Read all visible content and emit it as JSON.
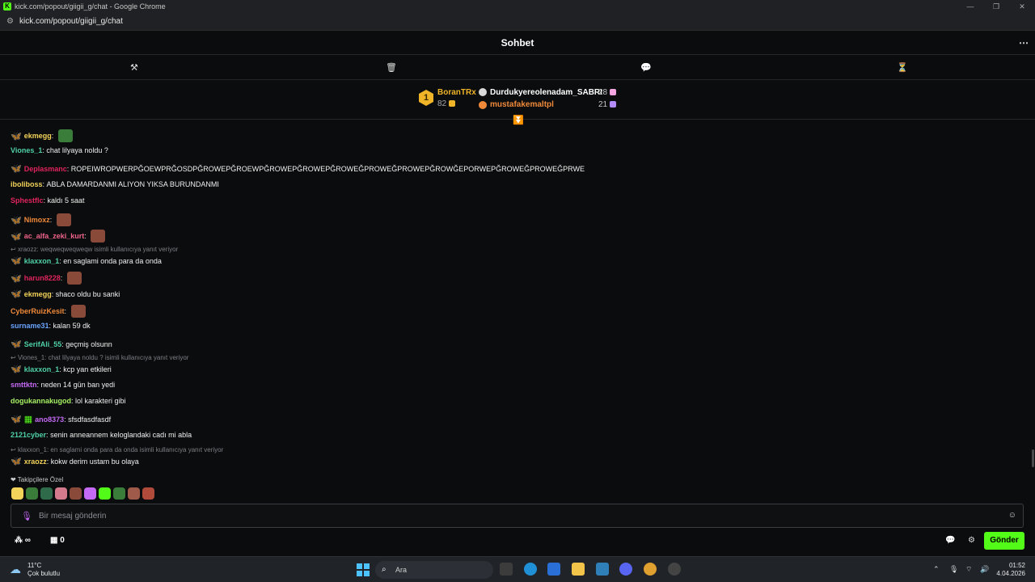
{
  "window": {
    "title": "kick.com/popout/giigii_g/chat - Google Chrome",
    "url": "kick.com/popout/giigii_g/chat"
  },
  "header": {
    "title": "Sohbet"
  },
  "leaderboard": {
    "rank1": {
      "rank": "1",
      "name": "BoranTRx",
      "count": "82"
    },
    "rank2": {
      "name": "Durdukyereolenadam_SABRI",
      "count": "28"
    },
    "rank3": {
      "name": "mustafakemaltpl",
      "count": "21"
    }
  },
  "colors": {
    "accent": "#53fc18",
    "gold": "#f0b429",
    "reply": "#7b7f86"
  },
  "messages": [
    {
      "user": "ekmegg",
      "color": "#f3d35a",
      "text": "",
      "badge": true,
      "emote": "#3a7d3a"
    },
    {
      "user": "Viones_1",
      "color": "#4fd1a5",
      "text": "chat lilyaya noldu ?",
      "badge": false
    },
    {
      "user": "Deplasmanc",
      "color": "#e0245e",
      "text": "ROPEIWROPWERPĞOEWPRĞOSDPĞROWEPĞROEWPĞROWEPĞROWEPĞROWEĞPROWEĞPROWEPĞROWĞEPORWEPĞROWEĞPROWEĞPRWE",
      "badge": true
    },
    {
      "user": "iboliboss",
      "color": "#f3d35a",
      "text": "ABLA DAMARDANMI ALIYON YIKSA BURUNDANMI",
      "badge": false
    },
    {
      "user": "Sphestflc",
      "color": "#e0245e",
      "text": "kaldı 5 saat",
      "badge": false
    },
    {
      "user": "Nimoxz",
      "color": "#f08a3a",
      "text": "",
      "badge": true,
      "emote": "#8a4a3a"
    },
    {
      "user": "ac_alfa_zeki_kurt",
      "color": "#f0648c",
      "text": "",
      "badge": true,
      "emote": "#8a4a3a"
    },
    {
      "user": "klaxxon_1",
      "color": "#4fd1a5",
      "text": "en saglami onda para da onda",
      "badge": true
    },
    {
      "user": "harun8228",
      "color": "#e0245e",
      "text": "",
      "badge": true,
      "emote": "#8a4a3a"
    },
    {
      "user": "ekmegg",
      "color": "#f3d35a",
      "text": "shaco oldu bu sanki",
      "badge": true
    },
    {
      "user": "CyberRuizKesit",
      "color": "#f08a3a",
      "text": "",
      "badge": false,
      "emote": "#8a4a3a"
    },
    {
      "user": "surname31",
      "color": "#6aa3ff",
      "text": "kalan 59 dk",
      "badge": false
    },
    {
      "user": "SerifAli_55",
      "color": "#4fd1a5",
      "text": "geçmiş olsunn",
      "badge": true
    },
    {
      "user": "klaxxon_1",
      "color": "#4fd1a5",
      "text": "kcp yan etkileri",
      "badge": true
    },
    {
      "user": "smttktn",
      "color": "#c46af5",
      "text": "neden 14 gün ban yedi",
      "badge": false
    },
    {
      "user": "dogukannakugod",
      "color": "#a6f063",
      "text": "lol karakteri gibi",
      "badge": false
    },
    {
      "user": "ano8373",
      "color": "#c46af5",
      "text": "sfsdfasdfasdf",
      "badge": true,
      "gift": true
    },
    {
      "user": "2121cyber",
      "color": "#4fd1a5",
      "text": "senin anneannem keloglandaki cadı mi abla",
      "badge": false
    },
    {
      "user": "xraozz",
      "color": "#f3d35a",
      "text": "kokw derim ustam bu olaya",
      "badge": true
    }
  ],
  "replies": [
    {
      "text": "xraozz: weqweqweqweqw isimli kullanıcıya yanıt veriyor"
    },
    {
      "text": "Viones_1: chat lilyaya noldu ? isimli kullanıcıya yanıt veriyor"
    },
    {
      "text": "klaxxon_1: en saglami onda para da onda isimli kullanıcıya yanıt veriyor"
    }
  ],
  "followers_label": "Takipçilere Özel",
  "input": {
    "placeholder": "Bir mesaj gönderin"
  },
  "bottom": {
    "points": "∞",
    "store_count": "0",
    "send_label": "Gönder"
  },
  "taskbar": {
    "temp": "11°C",
    "weather": "Çok bulutlu",
    "search": "Ara",
    "time": "01:52",
    "date": "4.04.2026"
  }
}
